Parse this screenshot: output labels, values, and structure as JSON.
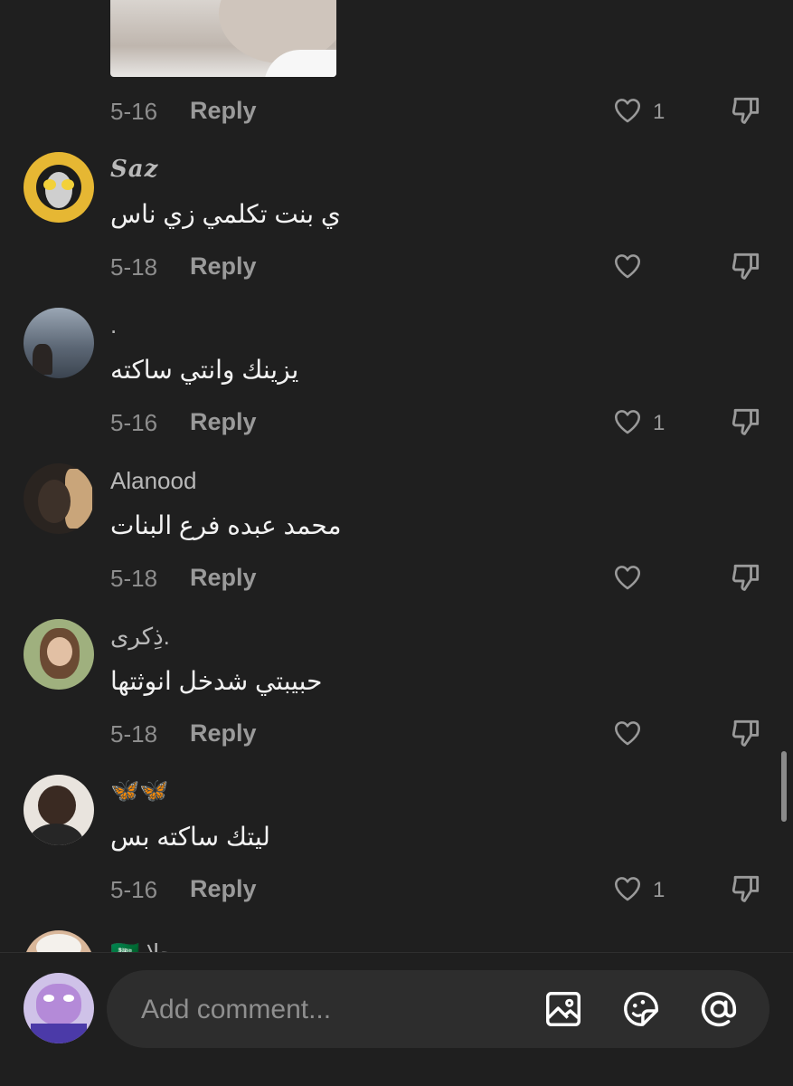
{
  "comments": [
    {
      "username": "",
      "text": "",
      "date": "5-16",
      "reply_label": "Reply",
      "likes": "1"
    },
    {
      "username": "Saz",
      "text": "ي بنت تكلمي زي ناس",
      "date": "5-18",
      "reply_label": "Reply",
      "likes": ""
    },
    {
      "username": ".",
      "text": "يزينك وانتي ساكته",
      "date": "5-16",
      "reply_label": "Reply",
      "likes": "1"
    },
    {
      "username": "Alanood",
      "text": "محمد عبده فرع البنات",
      "date": "5-18",
      "reply_label": "Reply",
      "likes": ""
    },
    {
      "username": "ذِكرى.",
      "text": "حبيبتي شدخل انوثتها",
      "date": "5-18",
      "reply_label": "Reply",
      "likes": ""
    },
    {
      "username": "🦋🦋",
      "text": "ليتك ساكته بس",
      "date": "5-16",
      "reply_label": "Reply",
      "likes": "1"
    },
    {
      "username": "🇸🇦 حلا",
      "text": "",
      "date": "",
      "reply_label": "",
      "likes": ""
    }
  ],
  "composer": {
    "placeholder": "Add comment...",
    "icons": [
      "image-icon",
      "emoji-icon",
      "mention-icon"
    ]
  },
  "colors": {
    "background": "#1f1f1f",
    "input": "#2d2d2d",
    "muted": "#8d8d8d"
  }
}
